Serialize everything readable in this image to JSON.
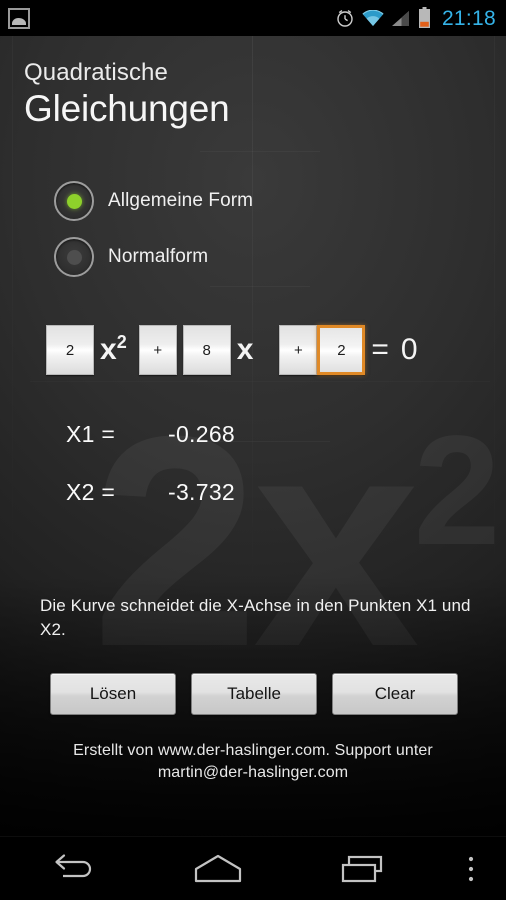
{
  "statusbar": {
    "notification_icon": "photo-icon",
    "icons": [
      "alarm-clock-icon",
      "wifi-icon",
      "cell-signal-icon",
      "battery-icon"
    ],
    "clock": "21:18",
    "clock_color": "#35b3e8",
    "battery_accent": "#e2601a"
  },
  "app": {
    "title_line1": "Quadratische",
    "title_line2": "Gleichungen",
    "watermark": {
      "base": "2x",
      "exponent": "2"
    }
  },
  "form_mode": {
    "options": [
      {
        "label": "Allgemeine Form",
        "selected": true
      },
      {
        "label": "Normalform",
        "selected": false
      }
    ],
    "selected_color": "#8ed12b"
  },
  "equation": {
    "coefficient_a": "2",
    "term_a": "x",
    "term_a_exponent": "2",
    "operator_1": "+",
    "coefficient_b": "8",
    "term_b": "x",
    "operator_2": "+",
    "coefficient_c": "2",
    "equals": "=",
    "right_side": "0",
    "focused_field": "coefficient_c",
    "focus_color": "#e08926"
  },
  "results": [
    {
      "label": "X1 =",
      "value": "-0.268"
    },
    {
      "label": "X2 =",
      "value": "-3.732"
    }
  ],
  "description": "Die Kurve schneidet die X-Achse in den Punkten X1 und X2.",
  "buttons": [
    {
      "label": "Lösen"
    },
    {
      "label": "Tabelle"
    },
    {
      "label": "Clear"
    }
  ],
  "footer": {
    "line1": "Erstellt von www.der-haslinger.com. Support unter",
    "line2": "martin@der-haslinger.com"
  },
  "navbar": {
    "back": "back-arrow-icon",
    "home": "home-icon",
    "recents": "recents-icon",
    "menu": "overflow-menu-icon"
  }
}
